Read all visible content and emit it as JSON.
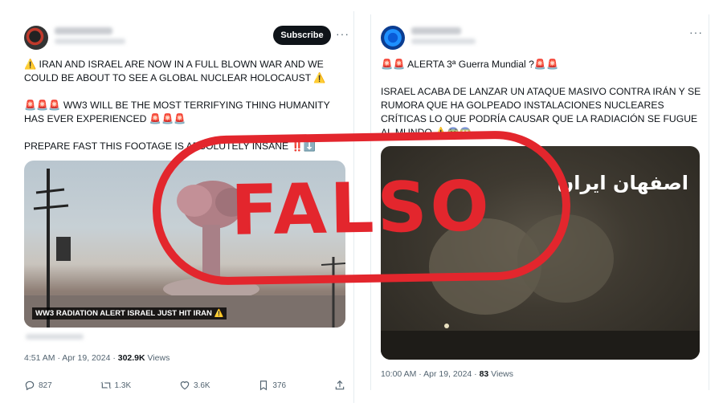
{
  "left_post": {
    "subscribe_label": "Subscribe",
    "more_icon": "more-dots-icon",
    "text": {
      "p1": "⚠️ IRAN AND ISRAEL ARE NOW IN A FULL BLOWN WAR AND WE COULD BE ABOUT TO SEE A GLOBAL NUCLEAR HOLOCAUST ⚠️",
      "p2": "🚨🚨🚨 WW3 WILL BE THE MOST TERRIFYING THING HUMANITY HAS EVER EXPERIENCED 🚨🚨🚨",
      "p3": "PREPARE FAST THIS FOOTAGE IS ABSOLUTELY INSANE ‼️⬇️"
    },
    "media_caption": "WW3 RADIATION ALERT ISRAEL JUST HIT IRAN ⚠️",
    "timestamp": "4:51 AM · Apr 19, 2024 · ",
    "views_count": "302.9K",
    "views_label": " Views",
    "actions": {
      "replies": "827",
      "reposts": "1.3K",
      "likes": "3.6K",
      "bookmarks": "376"
    }
  },
  "right_post": {
    "more_icon": "more-dots-icon",
    "text": {
      "p1": "🚨🚨 ALERTA 3ª Guerra Mundial ?🚨🚨",
      "p2": "ISRAEL ACABA DE LANZAR UN ATAQUE MASIVO CONTRA IRÁN Y SE RUMORA QUE HA GOLPEADO INSTALACIONES NUCLEARES CRÍTICAS LO QUE PODRÍA CAUSAR QUE LA RADIACIÓN SE FUGUE AL MUNDO ⚠️😨😱"
    },
    "media_overlay": "اصفهان ایران",
    "timestamp": "10:00 AM · Apr 19, 2024 · ",
    "views_count": "83",
    "views_label": " Views"
  },
  "stamp": {
    "label": "FALSO",
    "color": "#e3262d"
  }
}
